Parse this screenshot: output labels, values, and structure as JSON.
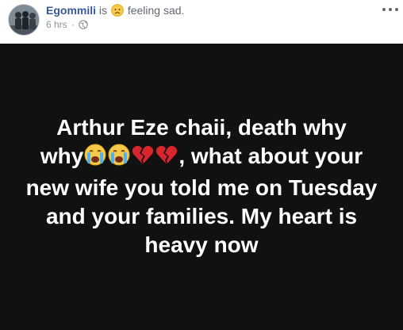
{
  "post": {
    "author": "Egommili",
    "connector": "is",
    "feeling_icon": "sad-face-icon",
    "feeling": "feeling sad.",
    "time": "6 hrs",
    "separator": "·",
    "privacy_icon": "globe-icon",
    "more_icon": "more-options-icon",
    "background_color": "#111111",
    "text_parts": {
      "line1": "Arthur Eze chaii, death why",
      "why": "why",
      "emojis": [
        "loudly-crying-face-icon",
        "loudly-crying-face-icon",
        "broken-heart-icon",
        "broken-heart-icon"
      ],
      "rest": ", what about your new wife you told me on Tuesday and your families. My heart is heavy now"
    }
  },
  "colors": {
    "author_link": "#385898",
    "meta_text": "#90949c",
    "post_text": "#ffffff"
  }
}
